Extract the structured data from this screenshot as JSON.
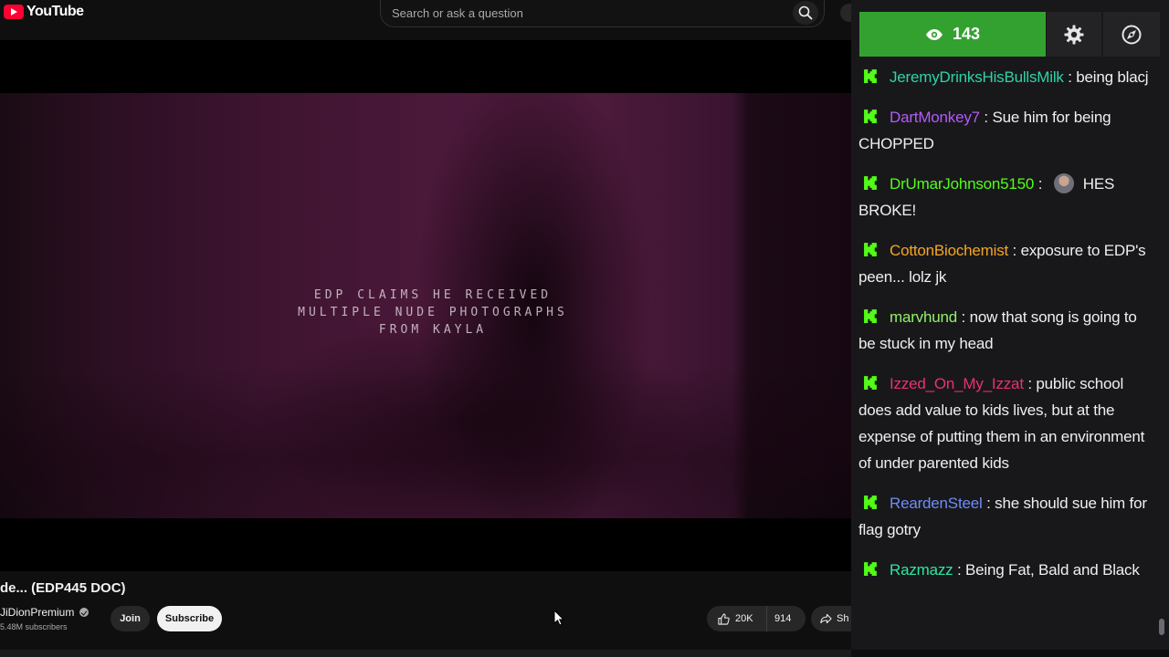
{
  "youtube": {
    "logo_text": "YouTube",
    "search_placeholder": "Search or ask a question",
    "video_caption_lines": [
      "EDP CLAIMS HE RECEIVED",
      "MULTIPLE NUDE PHOTOGRAPHS",
      "FROM KAYLA"
    ],
    "video_title": "de... (EDP445 DOC)",
    "channel_name": "JiDionPremium",
    "subscribers": "5.48M subscribers",
    "join_label": "Join",
    "subscribe_label": "Subscribe",
    "likes": "20K",
    "dislikes": "914",
    "share_label": "Sh"
  },
  "chat": {
    "viewer_count": "143",
    "colors": {
      "viewer_button": "#33a12f",
      "badge": "#53fc18"
    },
    "messages": [
      {
        "user": "JeremyDrinksHisBullsMilk",
        "color": "#2fd3a9",
        "text": "being blacj"
      },
      {
        "user": "DartMonkey7",
        "color": "#b45cf5",
        "text": "Sue him for being CHOPPED"
      },
      {
        "user": "DrUmarJohnson5150",
        "color": "#53fc18",
        "emote": true,
        "text": "HES BROKE!"
      },
      {
        "user": "CottonBiochemist",
        "color": "#f5a623",
        "text": "exposure to EDP's peen... lolz jk"
      },
      {
        "user": "marvhund",
        "color": "#93f067",
        "text": "now that song is going to be stuck in my head"
      },
      {
        "user": "Izzed_On_My_Izzat",
        "color": "#e8336d",
        "text": "public school does add value to kids lives, but at the expense of putting them in an environment of under parented kids"
      },
      {
        "user": "ReardenSteel",
        "color": "#6f8cf5",
        "text": "she should sue him for flag gotry"
      },
      {
        "user": "Razmazz",
        "color": "#2ee6a0",
        "text": "Being Fat, Bald and Black"
      }
    ]
  }
}
